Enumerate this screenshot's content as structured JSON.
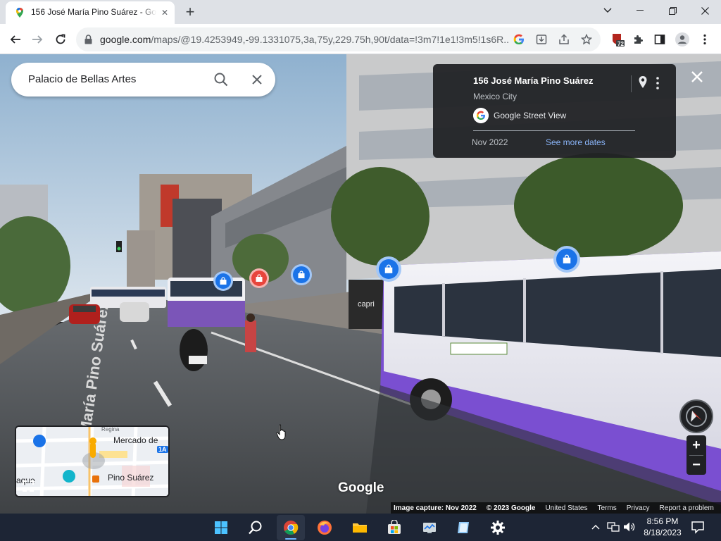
{
  "browser": {
    "tab_title": "156 José María Pino Suárez - Goo",
    "tab_close": "✕",
    "new_tab": "+",
    "url_host": "google.com",
    "url_path": "/maps/@19.4253949,-99.1331075,3a,75y,229.75h,90t/data=!3m7!1e1!3m5!1s6R...",
    "extension_badge": "72"
  },
  "streetview": {
    "search_value": "Palacio de Bellas Artes",
    "info_card": {
      "title": "156 José María Pino Suárez",
      "city": "Mexico City",
      "source": "Google Street View",
      "capture_month": "Nov 2022",
      "more_dates": "See more dates"
    },
    "street_sign_text": "María Pino Suárez",
    "storefront_text": "capri"
  },
  "minimap": {
    "label_regina": "Regina",
    "label_mercado": "Mercado de",
    "label_pino": "Pino Suárez",
    "label_aque": "aque",
    "badge_1a": "1A"
  },
  "controls": {
    "zoom_in": "+",
    "zoom_out": "−"
  },
  "watermark": "Google",
  "footer": {
    "capture": "Image capture: Nov 2022",
    "copyright": "© 2023 Google",
    "region": "United States",
    "terms": "Terms",
    "privacy": "Privacy",
    "report": "Report a problem"
  },
  "taskbar": {
    "time": "8:56 PM",
    "date": "8/18/2023"
  },
  "colors": {
    "accent_blue": "#1a73e8",
    "link_blue": "#8ab4f8",
    "card_bg": "#202124",
    "taskbar_bg": "#1d2535"
  }
}
